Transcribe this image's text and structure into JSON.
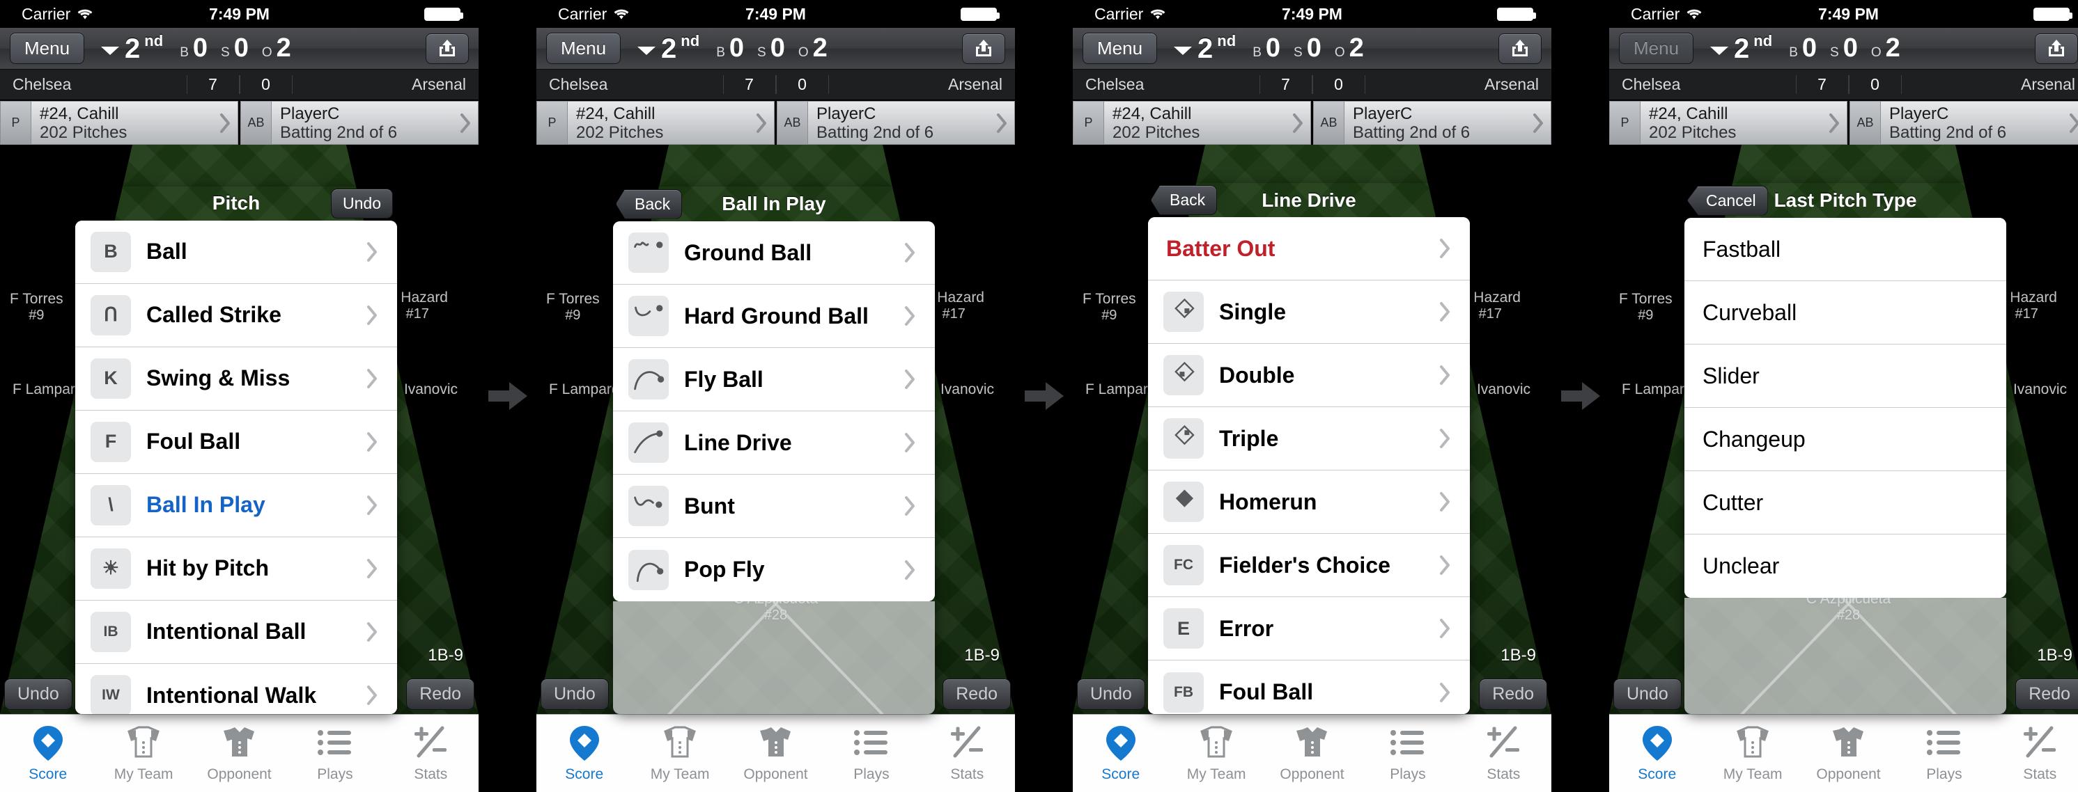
{
  "status": {
    "carrier": "Carrier",
    "time": "7:49 PM",
    "wifi_icon": "wifi-icon",
    "battery_icon": "battery-full-icon"
  },
  "nav": {
    "menu_label": "Menu",
    "inning_number": "2",
    "inning_ordinal": "nd",
    "balls_label": "B",
    "balls_value": "0",
    "strikes_label": "S",
    "strikes_value": "0",
    "outs_label": "O",
    "outs_value": "2",
    "share_icon": "share-icon",
    "caret_icon": "caret-down-icon"
  },
  "score": {
    "home_team": "Chelsea",
    "home_runs": "7",
    "away_runs": "0",
    "away_team": "Arsenal"
  },
  "matchup": {
    "pitcher_tag": "P",
    "pitcher_name": "#24, Cahill",
    "pitcher_detail": "202 Pitches",
    "batter_tag": "AB",
    "batter_name": "PlayerC",
    "batter_detail": "Batting 2nd of 6",
    "chevron_icon": "chevron-right-icon"
  },
  "field": {
    "left_fielder": "F Torres",
    "left_fielder_num": "#9",
    "left_label": "F Lampard",
    "center_label": "E Hazard",
    "center_num": "#17",
    "right_label": "Ivanovic",
    "catcher_name": "C Azpilicueta",
    "catcher_num": "#28",
    "position_label": "1B-9"
  },
  "actions": {
    "undo": "Undo",
    "redo": "Redo"
  },
  "tabbar": {
    "tabs": [
      {
        "label": "Score",
        "icon": "score-diamond-icon",
        "active": true
      },
      {
        "label": "My Team",
        "icon": "jersey-outline-icon",
        "active": false
      },
      {
        "label": "Opponent",
        "icon": "jersey-filled-icon",
        "active": false
      },
      {
        "label": "Plays",
        "icon": "list-icon",
        "active": false
      },
      {
        "label": "Stats",
        "icon": "plus-minus-icon",
        "active": false
      }
    ]
  },
  "panels": [
    {
      "id": "pitch",
      "title": "Pitch",
      "header_button": {
        "label": "Undo",
        "side": "right",
        "style": "plain"
      },
      "items": [
        {
          "badge": "B",
          "label": "Ball",
          "chevron": true,
          "style": "normal"
        },
        {
          "badge": "Ո",
          "label": "Called Strike",
          "chevron": true,
          "style": "normal"
        },
        {
          "badge": "K",
          "label": "Swing & Miss",
          "chevron": true,
          "style": "normal"
        },
        {
          "badge": "F",
          "label": "Foul Ball",
          "chevron": true,
          "style": "normal"
        },
        {
          "badge": "\\",
          "label": "Ball In Play",
          "chevron": true,
          "style": "blue"
        },
        {
          "badge": "☀",
          "label": "Hit by Pitch",
          "chevron": true,
          "style": "normal"
        },
        {
          "badge": "IB",
          "label": "Intentional Ball",
          "chevron": true,
          "style": "normal"
        },
        {
          "badge": "IW",
          "label": "Intentional Walk",
          "chevron": true,
          "style": "normal"
        }
      ]
    },
    {
      "id": "ball-in-play",
      "title": "Ball In Play",
      "header_button": {
        "label": "Back",
        "side": "left",
        "style": "back"
      },
      "items": [
        {
          "badge": "ground-ball-icon",
          "label": "Ground Ball",
          "chevron": true,
          "style": "normal"
        },
        {
          "badge": "hard-ground-ball-icon",
          "label": "Hard Ground Ball",
          "chevron": true,
          "style": "normal"
        },
        {
          "badge": "fly-ball-icon",
          "label": "Fly Ball",
          "chevron": true,
          "style": "normal"
        },
        {
          "badge": "line-drive-icon",
          "label": "Line Drive",
          "chevron": true,
          "style": "normal"
        },
        {
          "badge": "bunt-icon",
          "label": "Bunt",
          "chevron": true,
          "style": "normal"
        },
        {
          "badge": "pop-fly-icon",
          "label": "Pop Fly",
          "chevron": true,
          "style": "normal"
        }
      ]
    },
    {
      "id": "line-drive",
      "title": "Line Drive",
      "header_button": {
        "label": "Back",
        "side": "left",
        "style": "back"
      },
      "items": [
        {
          "badge": "",
          "label": "Batter Out",
          "chevron": true,
          "style": "red"
        },
        {
          "badge": "base-single-icon",
          "label": "Single",
          "chevron": true,
          "style": "normal"
        },
        {
          "badge": "base-double-icon",
          "label": "Double",
          "chevron": true,
          "style": "normal"
        },
        {
          "badge": "base-triple-icon",
          "label": "Triple",
          "chevron": true,
          "style": "normal"
        },
        {
          "badge": "base-home-icon",
          "label": "Homerun",
          "chevron": true,
          "style": "normal"
        },
        {
          "badge": "FC",
          "label": "Fielder's Choice",
          "chevron": true,
          "style": "normal"
        },
        {
          "badge": "E",
          "label": "Error",
          "chevron": true,
          "style": "normal"
        },
        {
          "badge": "FB",
          "label": "Foul Ball",
          "chevron": true,
          "style": "normal"
        }
      ]
    },
    {
      "id": "last-pitch-type",
      "title": "Last Pitch Type",
      "header_button": {
        "label": "Cancel",
        "side": "left",
        "style": "back"
      },
      "items": [
        {
          "badge": "",
          "label": "Fastball",
          "chevron": false,
          "style": "plain"
        },
        {
          "badge": "",
          "label": "Curveball",
          "chevron": false,
          "style": "plain"
        },
        {
          "badge": "",
          "label": "Slider",
          "chevron": false,
          "style": "plain"
        },
        {
          "badge": "",
          "label": "Changeup",
          "chevron": false,
          "style": "plain"
        },
        {
          "badge": "",
          "label": "Cutter",
          "chevron": false,
          "style": "plain"
        },
        {
          "badge": "",
          "label": "Unclear",
          "chevron": false,
          "style": "plain"
        }
      ]
    }
  ],
  "colors": {
    "accent_blue": "#1579d0",
    "link_blue": "#1464c8",
    "out_red": "#c0202a",
    "field_green": "#1d3c14"
  }
}
